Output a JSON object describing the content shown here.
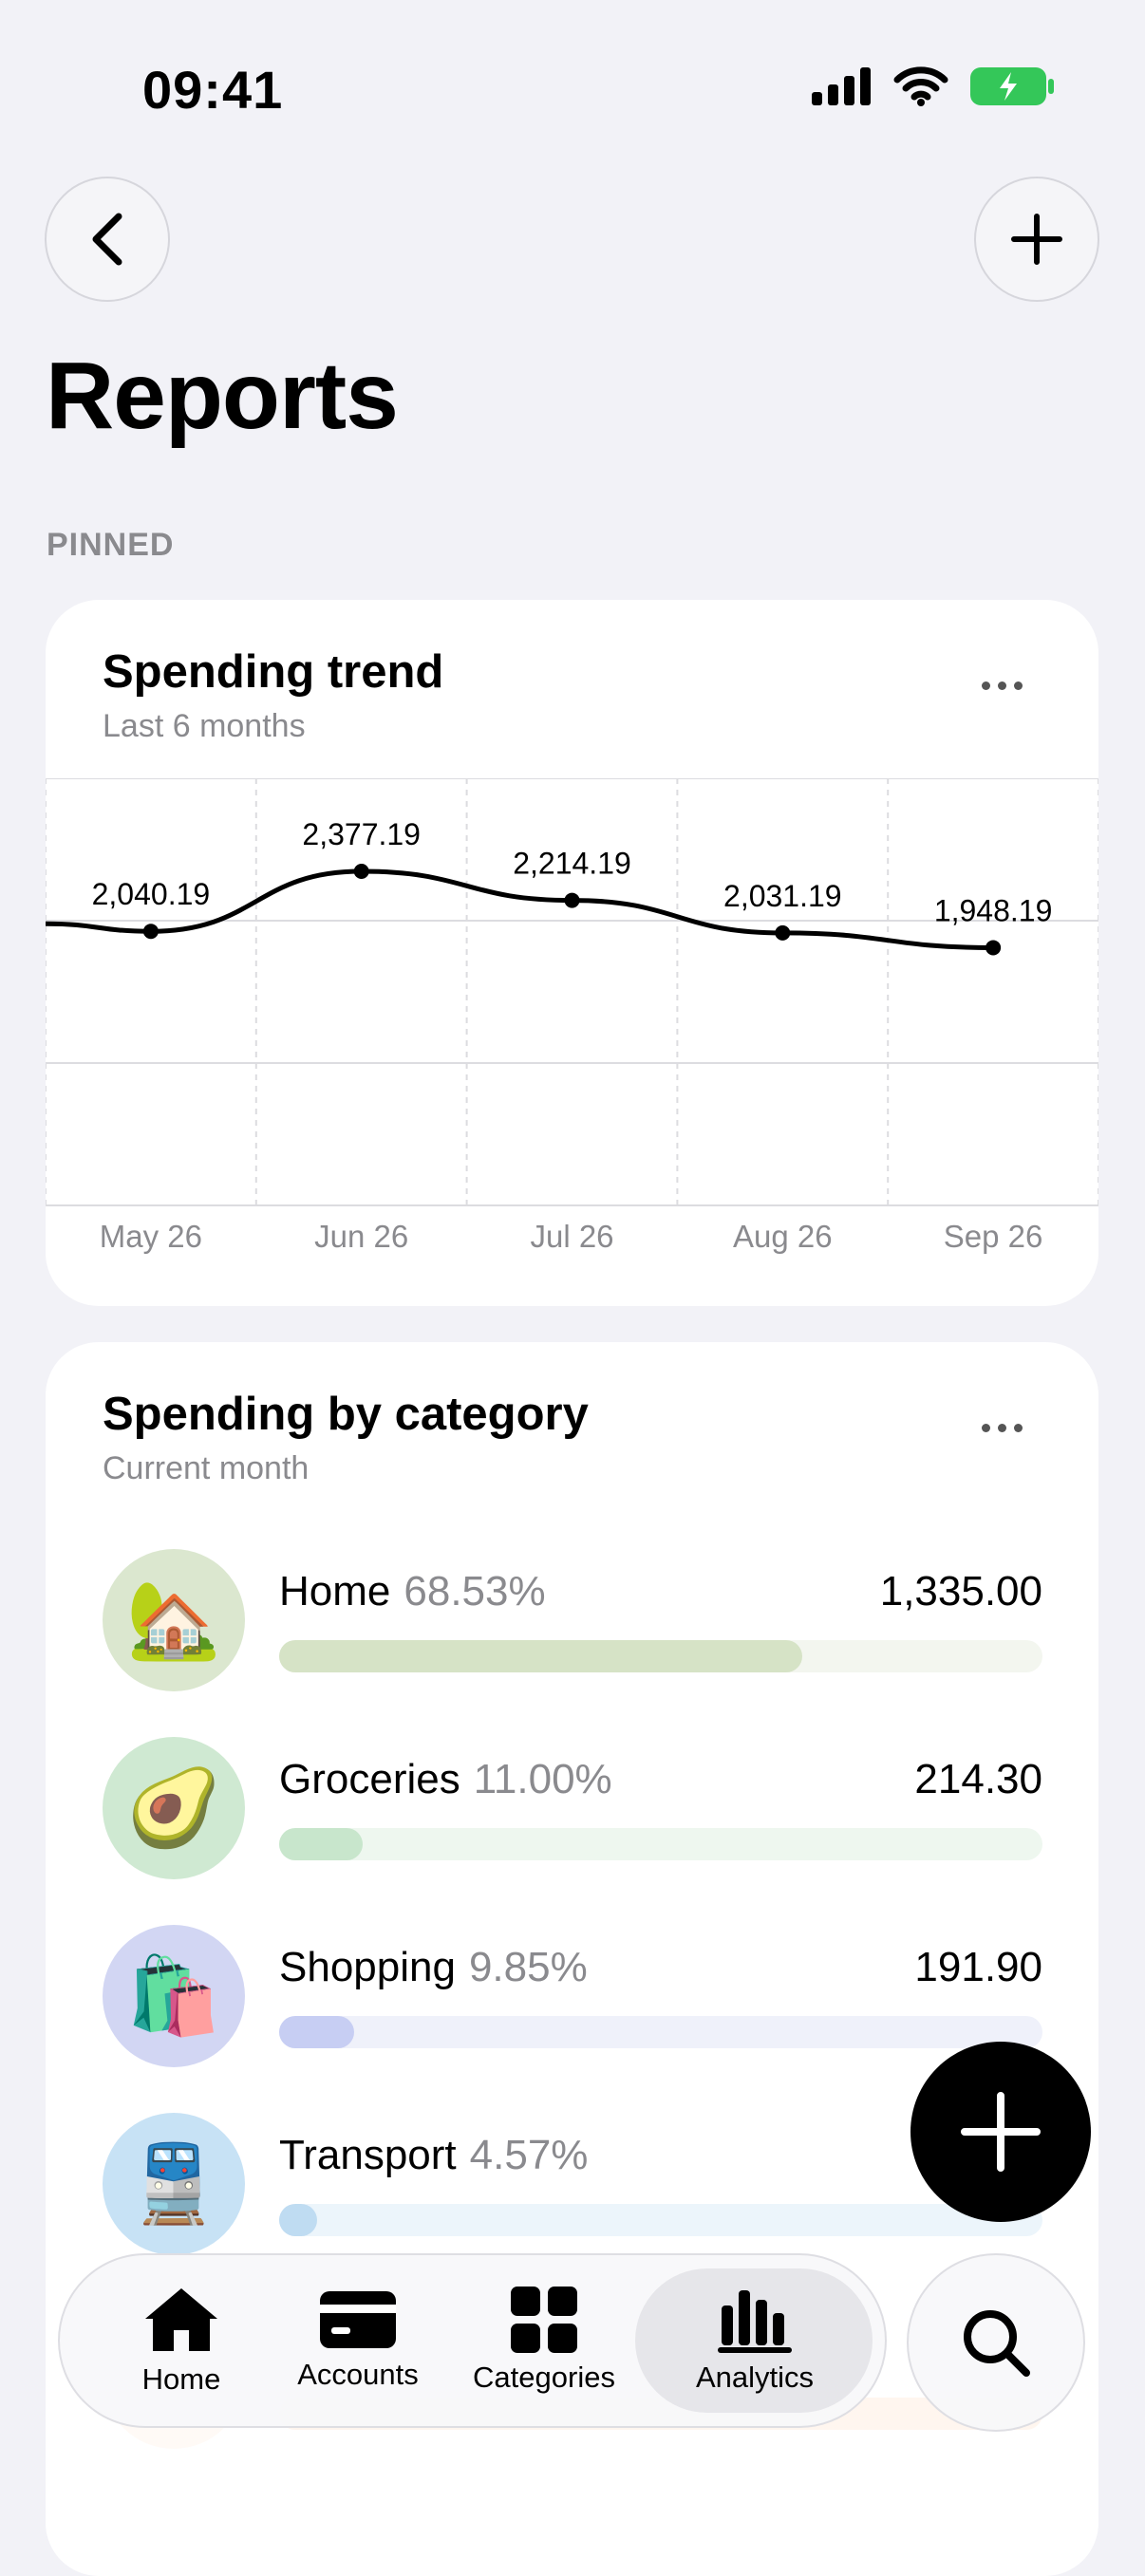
{
  "status_bar": {
    "time": "09:41"
  },
  "header": {
    "title": "Reports",
    "section_label": "PINNED"
  },
  "spending_trend": {
    "title": "Spending trend",
    "subtitle": "Last 6 months"
  },
  "chart_data": {
    "type": "line",
    "title": "Spending trend",
    "subtitle": "Last 6 months",
    "categories": [
      "May 26",
      "Jun 26",
      "Jul 26",
      "Aug 26",
      "Sep 26"
    ],
    "values": [
      2040.19,
      2377.19,
      2214.19,
      2031.19,
      1948.19
    ],
    "value_labels": [
      "2,040.19",
      "2,377.19",
      "2,214.19",
      "2,031.19",
      "1,948.19"
    ],
    "grid": true,
    "legend": "none"
  },
  "spending_by_category": {
    "title": "Spending by category",
    "subtitle": "Current month",
    "items": [
      {
        "name": "Home",
        "percent": "68.53%",
        "amount": "1,335.00",
        "share": 0.6853,
        "emoji": "🏡",
        "avatar_color": "#dbe7cf",
        "fill_color": "#d6e3c6",
        "track_color": "#f3f6ef",
        "icon": "house-icon"
      },
      {
        "name": "Groceries",
        "percent": "11.00%",
        "amount": "214.30",
        "share": 0.11,
        "emoji": "🥑",
        "avatar_color": "#cfe9d2",
        "fill_color": "#c8e6cc",
        "track_color": "#eef7ef",
        "icon": "avocado-icon"
      },
      {
        "name": "Shopping",
        "percent": "9.85%",
        "amount": "191.90",
        "share": 0.0985,
        "emoji": "🛍️",
        "avatar_color": "#d2d6f3",
        "fill_color": "#c7cef3",
        "track_color": "#eff1fa",
        "icon": "shopping-bags-icon"
      },
      {
        "name": "Transport",
        "percent": "4.57%",
        "amount": "",
        "share": 0.0457,
        "emoji": "🚆",
        "avatar_color": "#c7e2f5",
        "fill_color": "#bfdcf2",
        "track_color": "#ecf5fb",
        "icon": "train-icon"
      }
    ]
  },
  "tabbar": {
    "tabs": [
      {
        "label": "Home",
        "icon": "house-icon"
      },
      {
        "label": "Accounts",
        "icon": "card-icon"
      },
      {
        "label": "Categories",
        "icon": "grid-icon"
      },
      {
        "label": "Analytics",
        "icon": "bar-chart-icon",
        "active": true
      }
    ]
  },
  "colors": {
    "background": "#f2f2f7",
    "card": "#ffffff",
    "accent": "#000000",
    "muted": "#8a8a8e"
  }
}
